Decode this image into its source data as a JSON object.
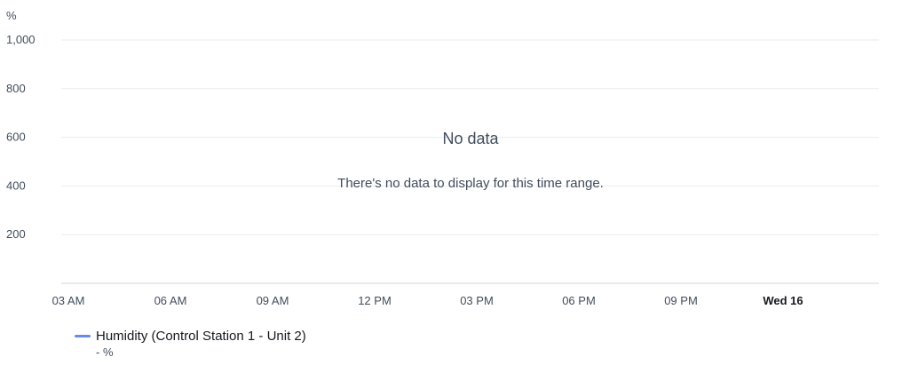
{
  "chart_data": {
    "type": "line",
    "title": "",
    "xlabel": "",
    "ylabel": "%",
    "ylim": [
      0,
      1000
    ],
    "y_ticks": [
      "1,000",
      "800",
      "600",
      "400",
      "200"
    ],
    "y_tick_values": [
      1000,
      800,
      600,
      400,
      200
    ],
    "x_ticks": [
      {
        "label": "03 AM",
        "bold": false
      },
      {
        "label": "06 AM",
        "bold": false
      },
      {
        "label": "09 AM",
        "bold": false
      },
      {
        "label": "12 PM",
        "bold": false
      },
      {
        "label": "03 PM",
        "bold": false
      },
      {
        "label": "06 PM",
        "bold": false
      },
      {
        "label": "09 PM",
        "bold": false
      },
      {
        "label": "Wed 16",
        "bold": true
      }
    ],
    "series": [
      {
        "name": "Humidity (Control Station 1 - Unit 2)",
        "values": [],
        "color": "#688ae8"
      }
    ],
    "grid": true,
    "legend_position": "bottom-left",
    "empty_state": {
      "title": "No data",
      "message": "There's no data to display for this time range."
    },
    "legend_value": "- %"
  }
}
